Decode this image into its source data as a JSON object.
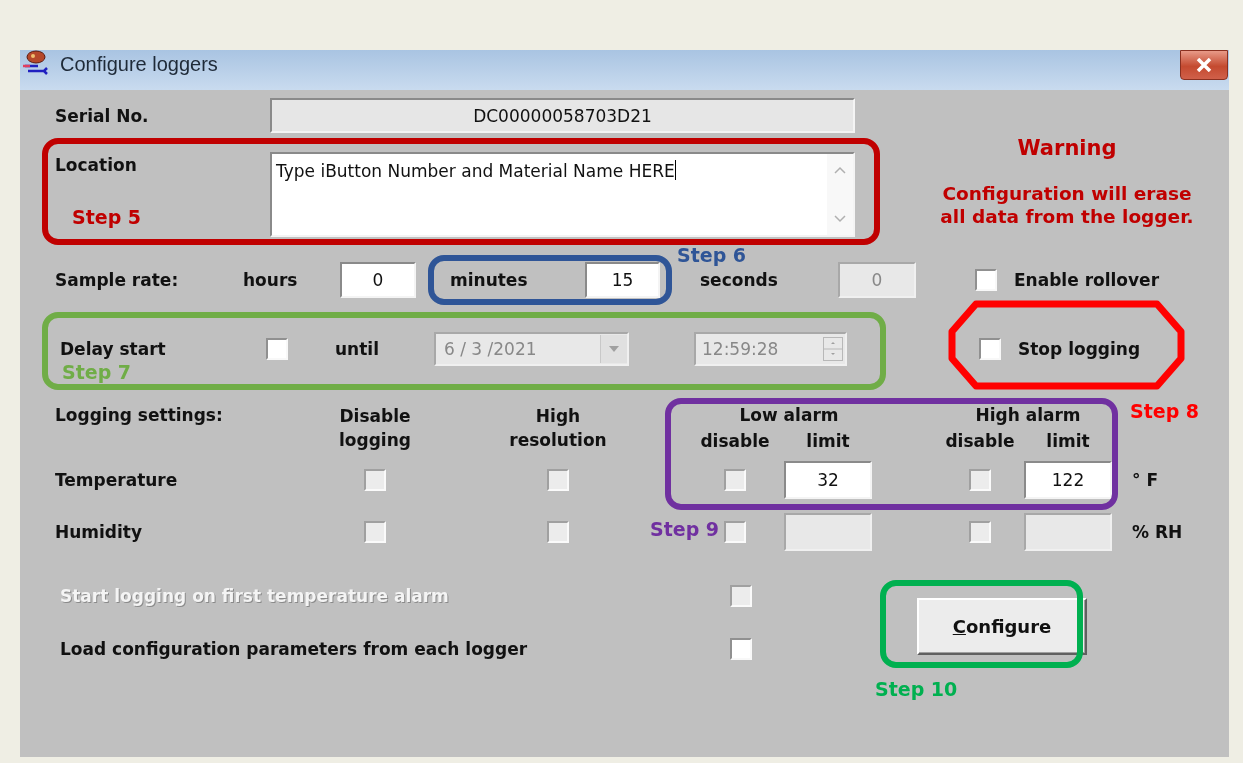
{
  "window": {
    "title": "Configure loggers"
  },
  "serial": {
    "label": "Serial No.",
    "value": "DC00000058703D21"
  },
  "location": {
    "label": "Location",
    "value": "Type iButton Number and Material Name HERE"
  },
  "warning": {
    "title": "Warning",
    "message": "Configuration will erase all data from the logger."
  },
  "sample_rate": {
    "label": "Sample rate:",
    "fields": [
      {
        "label": "hours",
        "value": "0",
        "disabled": false
      },
      {
        "label": "minutes",
        "value": "15",
        "disabled": false
      },
      {
        "label": "seconds",
        "value": "0",
        "disabled": true
      }
    ]
  },
  "enable_rollover": {
    "label": "Enable rollover",
    "checked": false
  },
  "delay_start": {
    "label": "Delay start",
    "checked": false,
    "until_label": "until",
    "date": "6 / 3 /2021",
    "time": "12:59:28",
    "disabled": true
  },
  "stop_logging": {
    "label": "Stop logging",
    "checked": false
  },
  "logging_settings": {
    "label": "Logging settings:",
    "columns": [
      "Disable logging",
      "High resolution"
    ],
    "low_alarm": {
      "title": "Low alarm",
      "disable_label": "disable",
      "limit_label": "limit"
    },
    "high_alarm": {
      "title": "High alarm",
      "disable_label": "disable",
      "limit_label": "limit"
    },
    "rows": [
      {
        "name": "Temperature",
        "disable_logging": false,
        "high_resolution": false,
        "low_disable": false,
        "low_limit": "32",
        "high_disable": false,
        "high_limit": "122",
        "limits_disabled": false,
        "unit": "° F"
      },
      {
        "name": "Humidity",
        "disable_logging": false,
        "high_resolution": false,
        "low_disable": false,
        "high_disable": false,
        "limits_disabled": true,
        "unit": "% RH"
      }
    ]
  },
  "options": [
    {
      "label": "Start logging on first temperature alarm",
      "checked": false,
      "disabled": true
    },
    {
      "label": "Load configuration parameters from each logger",
      "checked": false,
      "disabled": false
    }
  ],
  "configure_button": {
    "access_key": "C",
    "label_after_key": "onfigure"
  },
  "annotations": [
    {
      "label": "Step 5",
      "kind": "box",
      "color": "#c00000"
    },
    {
      "label": "Step 6",
      "kind": "box",
      "color": "#2f5597"
    },
    {
      "label": "Step 7",
      "kind": "box",
      "color": "#70ad47"
    },
    {
      "label": "Step 8",
      "kind": "octagon",
      "color": "#ff0000"
    },
    {
      "label": "Step 9",
      "kind": "box",
      "color": "#7030a0"
    },
    {
      "label": "Step 10",
      "kind": "box",
      "color": "#00b050"
    }
  ]
}
